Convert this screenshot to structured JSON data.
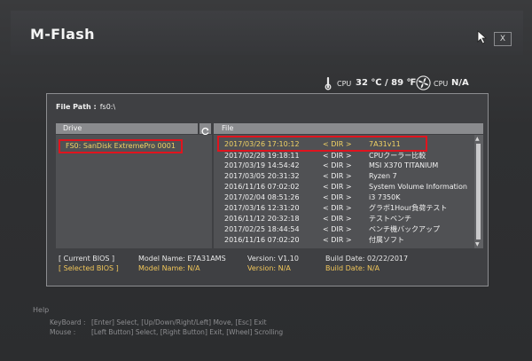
{
  "app": {
    "title": "M-Flash",
    "close_label": "X"
  },
  "status": {
    "cpu_temp_label": "CPU",
    "cpu_temp_value": "32 ℃ / 89 ℉",
    "fan_label": "CPU",
    "fan_value": "N/A"
  },
  "file_path": {
    "label": "File Path :",
    "value": "fs0:\\"
  },
  "drive_panel": {
    "header": "Drive",
    "items": [
      "FS0: SanDisk ExtremePro 0001"
    ]
  },
  "file_panel": {
    "header": "File",
    "rows": [
      {
        "date": "2017/03/26 17:10:12",
        "type": "< DIR >",
        "name": "7A31v11"
      },
      {
        "date": "2017/02/28 19:18:11",
        "type": "< DIR >",
        "name": "CPUクーラー比較"
      },
      {
        "date": "2017/03/19 14:54:42",
        "type": "< DIR >",
        "name": "MSI X370 TITANIUM"
      },
      {
        "date": "2017/03/05 20:31:32",
        "type": "< DIR >",
        "name": "Ryzen 7"
      },
      {
        "date": "2016/11/16 07:02:02",
        "type": "< DIR >",
        "name": "System Volume Information"
      },
      {
        "date": "2017/02/04 08:51:26",
        "type": "< DIR >",
        "name": "i3 7350K"
      },
      {
        "date": "2017/03/16 12:31:20",
        "type": "< DIR >",
        "name": "グラボ1Hour負荷テスト"
      },
      {
        "date": "2016/11/12 20:32:18",
        "type": "< DIR >",
        "name": "テストベンチ"
      },
      {
        "date": "2017/02/25 18:44:54",
        "type": "< DIR >",
        "name": "ベンチ機バックアップ"
      },
      {
        "date": "2016/11/16 07:02:20",
        "type": "< DIR >",
        "name": "付属ソフト"
      }
    ]
  },
  "bios_info": {
    "current": {
      "label": "[ Current BIOS ]",
      "model": "Model Name: E7A31AMS",
      "version": "Version: V1.10",
      "build": "Build Date: 02/22/2017"
    },
    "selected": {
      "label": "[ Selected BIOS ]",
      "model": "Model Name: N/A",
      "version": "Version: N/A",
      "build": "Build Date: N/A"
    }
  },
  "help": {
    "title": "Help",
    "keyboard_label": "KeyBoard :",
    "keyboard_text": "[Enter] Select,   [Up/Down/Right/Left]  Move,   [Esc]  Exit",
    "mouse_label": "Mouse    :",
    "mouse_text": "[Left Button]  Select,   [Right Button]  Exit,   [Wheel]  Scrolling"
  },
  "colors": {
    "accent_gold": "#f1c65a",
    "highlight_red": "#e0141e",
    "header_gray": "#8a8b8e"
  },
  "icons": {
    "temperature": "thermometer-icon",
    "fan": "fan-icon",
    "refresh": "refresh-icon",
    "cursor": "mouse-pointer-icon"
  }
}
